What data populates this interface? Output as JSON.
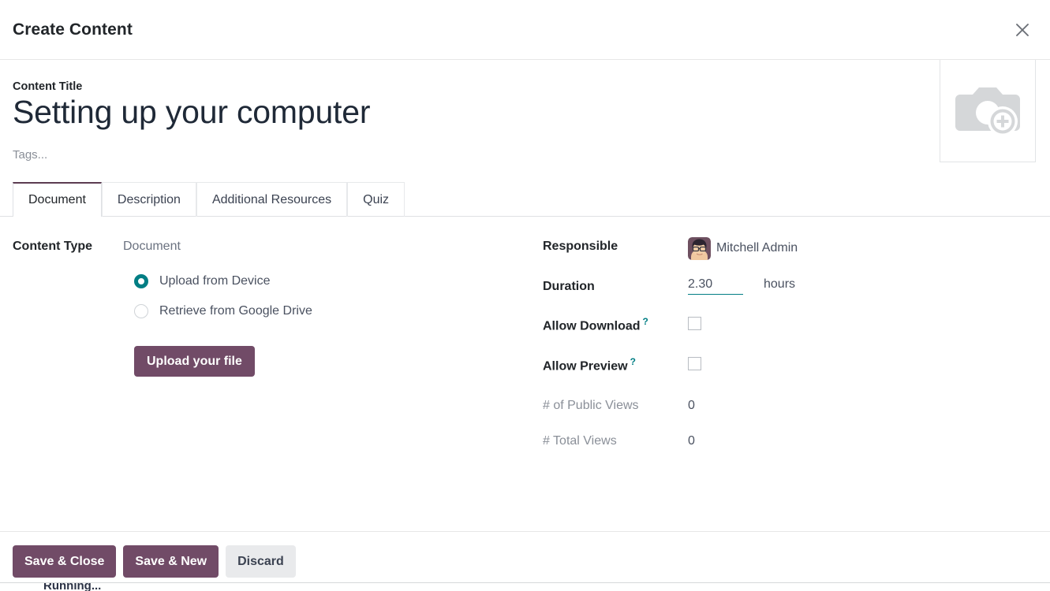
{
  "dialog": {
    "title": "Create Content",
    "close_icon": "close-icon"
  },
  "title_section": {
    "label": "Content Title",
    "value": "Setting up your computer",
    "tags_placeholder": "Tags...",
    "image_placeholder_icon": "camera-add-icon"
  },
  "tabs": [
    {
      "label": "Document",
      "active": true
    },
    {
      "label": "Description",
      "active": false
    },
    {
      "label": "Additional Resources",
      "active": false
    },
    {
      "label": "Quiz",
      "active": false
    }
  ],
  "left_column": {
    "content_type": {
      "label": "Content Type",
      "value": "Document"
    },
    "source_options": [
      {
        "label": "Upload from Device",
        "selected": true
      },
      {
        "label": "Retrieve from Google Drive",
        "selected": false
      }
    ],
    "upload_button": "Upload your file"
  },
  "right_column": {
    "responsible": {
      "label": "Responsible",
      "value": "Mitchell Admin",
      "avatar_icon": "user-avatar"
    },
    "duration": {
      "label": "Duration",
      "value": "2.30",
      "unit": "hours"
    },
    "allow_download": {
      "label": "Allow Download",
      "help": "?",
      "checked": false
    },
    "allow_preview": {
      "label": "Allow Preview",
      "help": "?",
      "checked": false
    },
    "public_views": {
      "label": "# of Public Views",
      "value": "0"
    },
    "total_views": {
      "label": "# Total Views",
      "value": "0"
    }
  },
  "footer": {
    "save_close": "Save & Close",
    "save_new": "Save & New",
    "discard": "Discard"
  },
  "background": {
    "obscured_text": "Running..."
  },
  "colors": {
    "primary": "#714b67",
    "accent_teal": "#017e84",
    "tab_active_border": "#5c3c51",
    "secondary_button": "#e9eaec"
  }
}
